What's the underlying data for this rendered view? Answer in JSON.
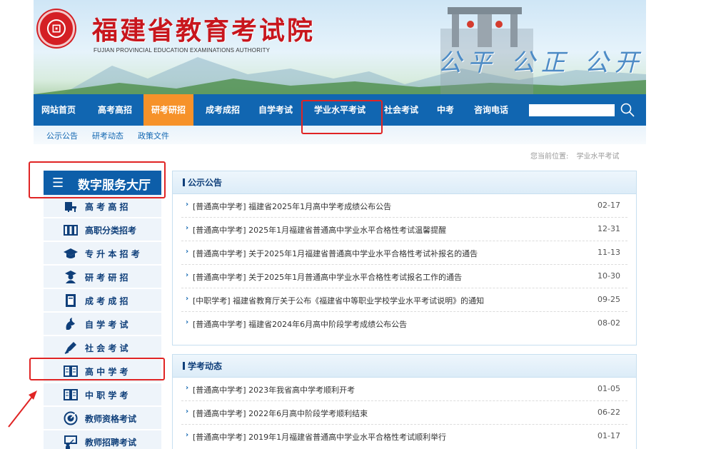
{
  "header": {
    "title": "福建省教育考试院",
    "subtitle": "FUJIAN PROVINCIAL EDUCATION EXAMINATIONS AUTHORITY",
    "motto": "公平 公正 公开"
  },
  "nav": {
    "items": [
      "网站首页",
      "高考高招",
      "研考研招",
      "成考成招",
      "自学考试",
      "学业水平考试",
      "社会考试",
      "中考",
      "咨询电话"
    ],
    "active": "研考研招",
    "search_placeholder": ""
  },
  "subnav": {
    "items": [
      "公示公告",
      "研考动态",
      "政策文件"
    ]
  },
  "location": {
    "label": "您当前位置:",
    "value": "学业水平考试"
  },
  "sidebar": {
    "title": "数字服务大厅",
    "items": [
      {
        "label": "高 考 高 招",
        "icon": "desk-icon"
      },
      {
        "label": "高职分类招考",
        "icon": "books-icon"
      },
      {
        "label": "专 升 本 招 考",
        "icon": "graduation-cap-icon"
      },
      {
        "label": "研 考 研 招",
        "icon": "scholar-icon"
      },
      {
        "label": "成 考 成 招",
        "icon": "notebook-icon"
      },
      {
        "label": "自 学 考 试",
        "icon": "flame-book-icon"
      },
      {
        "label": "社 会 考 试",
        "icon": "pen-icon"
      },
      {
        "label": "高 中 学 考",
        "icon": "open-book-icon"
      },
      {
        "label": "中 职 学 考",
        "icon": "open-book-icon"
      },
      {
        "label": "教师资格考试",
        "icon": "target-icon"
      },
      {
        "label": "教师招聘考试",
        "icon": "teacher-icon"
      }
    ]
  },
  "notices": {
    "title": "公示公告",
    "rows": [
      {
        "text": "[普通高中学考] 福建省2025年1月高中学考成绩公布公告",
        "date": "02-17"
      },
      {
        "text": "[普通高中学考] 2025年1月福建省普通高中学业水平合格性考试温馨提醒",
        "date": "12-31"
      },
      {
        "text": "[普通高中学考] 关于2025年1月福建省普通高中学业水平合格性考试补报名的通告",
        "date": "11-13"
      },
      {
        "text": "[普通高中学考] 关于2025年1月普通高中学业水平合格性考试报名工作的通告",
        "date": "10-30"
      },
      {
        "text": "[中职学考] 福建省教育厅关于公布《福建省中等职业学校学业水平考试说明》的通知",
        "date": "09-25"
      },
      {
        "text": "[普通高中学考] 福建省2024年6月高中阶段学考成绩公布公告",
        "date": "08-02"
      }
    ]
  },
  "news": {
    "title": "学考动态",
    "rows": [
      {
        "text": "[普通高中学考] 2023年我省高中学考顺利开考",
        "date": "01-05"
      },
      {
        "text": "[普通高中学考] 2022年6月高中阶段学考顺利结束",
        "date": "06-22"
      },
      {
        "text": "[普通高中学考] 2019年1月福建省普通高中学业水平合格性考试顺利举行",
        "date": "01-17"
      }
    ]
  },
  "colors": {
    "nav_blue": "#1166b1",
    "active_orange": "#f6922a",
    "title_red": "#c8161d",
    "annotation_red": "#e02424"
  }
}
